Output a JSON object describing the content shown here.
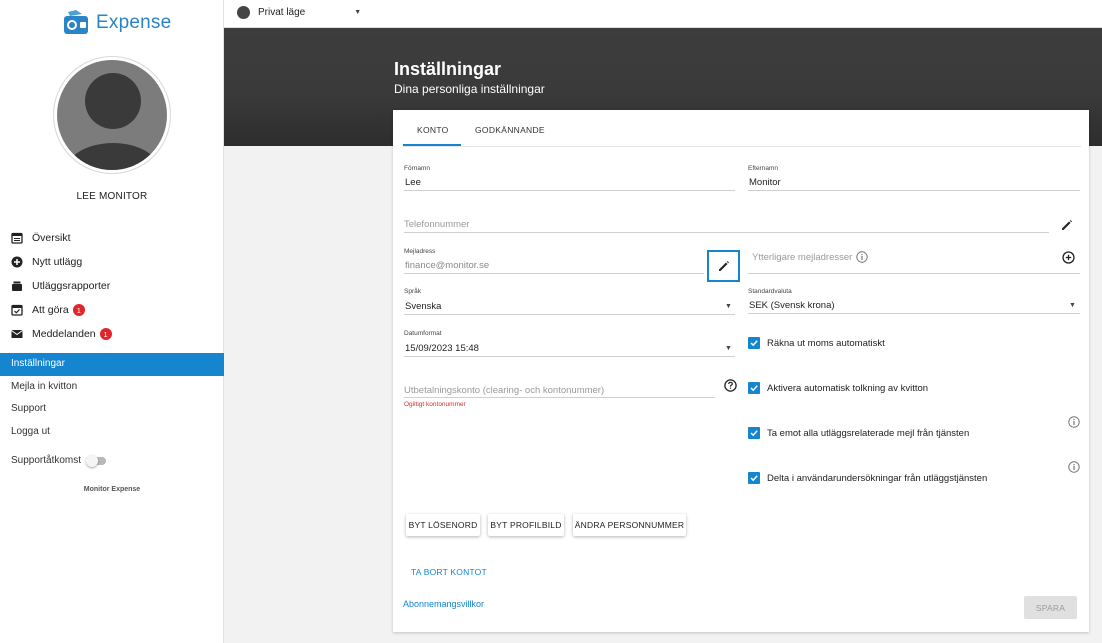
{
  "brand": {
    "name": "Expense",
    "color": "#2a84c6",
    "footer": "Monitor Expense"
  },
  "user": {
    "name": "LEE MONITOR"
  },
  "nav": {
    "items": [
      {
        "label": "Översikt",
        "icon": "calendar-list-icon"
      },
      {
        "label": "Nytt utlägg",
        "icon": "plus-circle-icon"
      },
      {
        "label": "Utläggsrapporter",
        "icon": "inbox-tray-icon"
      },
      {
        "label": "Att göra",
        "icon": "checked-calendar-icon",
        "badge": "1"
      },
      {
        "label": "Meddelanden",
        "icon": "envelope-icon",
        "badge": "1"
      }
    ],
    "secondary": [
      {
        "label": "Inställningar",
        "active": true
      },
      {
        "label": "Mejla in kvitton"
      },
      {
        "label": "Support"
      },
      {
        "label": "Logga ut"
      }
    ],
    "support_access": "Supportåtkomst"
  },
  "topbar": {
    "mode": "Privat läge"
  },
  "header": {
    "title": "Inställningar",
    "subtitle": "Dina personliga inställningar"
  },
  "tabs": [
    {
      "label": "KONTO",
      "active": true
    },
    {
      "label": "GODKÄNNANDE"
    }
  ],
  "form": {
    "first_name": {
      "label": "Förnamn",
      "value": "Lee"
    },
    "last_name": {
      "label": "Efternamn",
      "value": "Monitor"
    },
    "phone": {
      "placeholder": "Telefonnummer"
    },
    "email": {
      "label": "Mejladress",
      "value": "finance@monitor.se"
    },
    "extra_emails": {
      "placeholder": "Ytterligare mejladresser"
    },
    "language": {
      "label": "Språk",
      "value": "Svenska"
    },
    "currency": {
      "label": "Standardvaluta",
      "value": "SEK (Svensk krona)"
    },
    "date_format": {
      "label": "Datumformat",
      "value": "15/09/2023 15:48"
    },
    "payout_account": {
      "placeholder": "Utbetalningskonto (clearing- och kontonummer)",
      "error": "Ogiltigt kontonummer"
    }
  },
  "checkboxes": [
    {
      "label": "Räkna ut moms automatiskt",
      "checked": true
    },
    {
      "label": "Aktivera automatisk tolkning av kvitton",
      "checked": true
    },
    {
      "label": "Ta emot alla utläggsrelaterade mejl från tjänsten",
      "checked": true
    },
    {
      "label": "Delta i användarundersökningar från utläggstjänsten",
      "checked": true
    }
  ],
  "buttons": {
    "change_password": "BYT LÖSENORD",
    "change_photo": "BYT PROFILBILD",
    "change_personal_number": "ÄNDRA PERSONNUMMER",
    "delete_account": "TA BORT KONTOT",
    "terms": "Abonnemangsvillkor",
    "save": "SPARA"
  },
  "colors": {
    "accent": "#1585d0",
    "badge": "#e0252b",
    "error": "#d32f2f",
    "header": "#3a3a3a"
  }
}
